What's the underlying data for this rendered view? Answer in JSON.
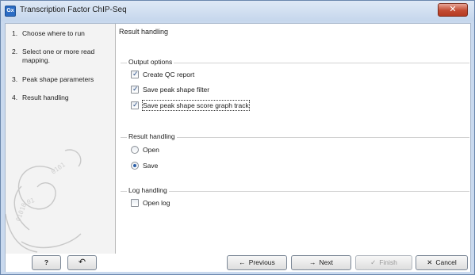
{
  "window": {
    "title": "Transcription Factor ChIP-Seq",
    "app_icon_text": "Gx",
    "close_glyph": "✕"
  },
  "sidebar": {
    "steps": [
      {
        "num": "1.",
        "label": "Choose where to run"
      },
      {
        "num": "2.",
        "label": "Select one or more read mapping."
      },
      {
        "num": "3.",
        "label": "Peak shape parameters"
      },
      {
        "num": "4.",
        "label": "Result handling"
      }
    ]
  },
  "content": {
    "title": "Result handling",
    "output_options": {
      "label": "Output options",
      "items": [
        {
          "label": "Create QC report",
          "checked": true
        },
        {
          "label": "Save peak shape filter",
          "checked": true
        },
        {
          "label": "Save peak shape score graph track",
          "checked": true
        }
      ]
    },
    "result_handling": {
      "label": "Result handling",
      "options": [
        {
          "label": "Open",
          "selected": false
        },
        {
          "label": "Save",
          "selected": true
        }
      ]
    },
    "log_handling": {
      "label": "Log handling",
      "items": [
        {
          "label": "Open log",
          "checked": false
        }
      ]
    }
  },
  "footer": {
    "help_label": "?",
    "reset_glyph": "↶",
    "previous_label": "Previous",
    "previous_glyph": "←",
    "next_label": "Next",
    "next_glyph": "→",
    "finish_label": "Finish",
    "finish_glyph": "✓",
    "cancel_label": "Cancel",
    "cancel_glyph": "✕"
  }
}
